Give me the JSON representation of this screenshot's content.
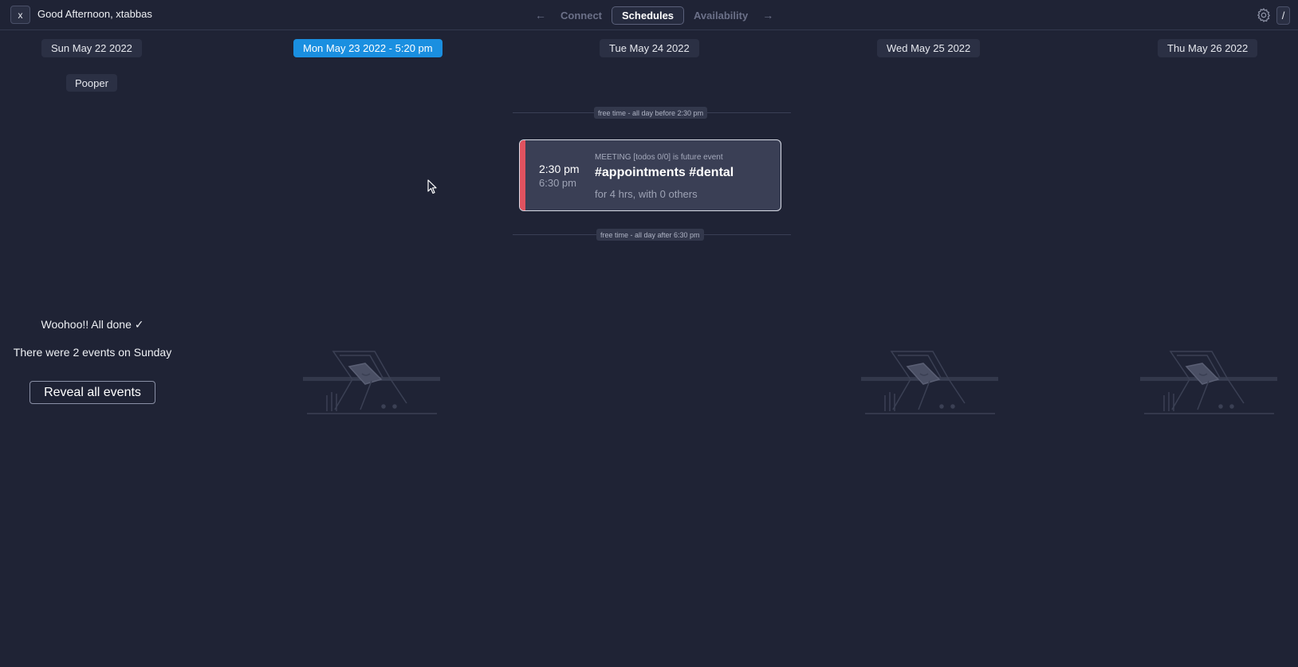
{
  "header": {
    "close_label": "x",
    "greeting": "Good Afternoon, xtabbas",
    "nav": {
      "prev_arrow": "←",
      "next_arrow": "→",
      "tabs": [
        {
          "label": "Connect",
          "active": false
        },
        {
          "label": "Schedules",
          "active": true
        },
        {
          "label": "Availability",
          "active": false
        }
      ]
    },
    "slash_label": "/"
  },
  "days": [
    {
      "label": "Sun May 22 2022",
      "today": false
    },
    {
      "label": "Mon May 23 2022  - 5:20 pm",
      "today": true
    },
    {
      "label": "Tue May 24 2022",
      "today": false
    },
    {
      "label": "Wed May 25 2022",
      "today": false
    },
    {
      "label": "Thu May 26 2022",
      "today": false
    }
  ],
  "sunday": {
    "tag": "Pooper",
    "done_title": "Woohoo!! All done ✓",
    "done_sub": "There were 2 events on Sunday",
    "reveal_label": "Reveal all events"
  },
  "tuesday": {
    "free_before": "free time - all day before 2:30 pm",
    "free_after": "free time - all day after 6:30 pm",
    "event": {
      "start": "2:30 pm",
      "end": "6:30 pm",
      "meta": "MEETING [todos 0/0] is future event",
      "title": "#appointments #dental",
      "sub": "for 4 hrs, with 0 others"
    }
  },
  "colors": {
    "background": "#1f2335",
    "today_accent": "#1a8fe0",
    "event_stripe": "#e0525f"
  }
}
